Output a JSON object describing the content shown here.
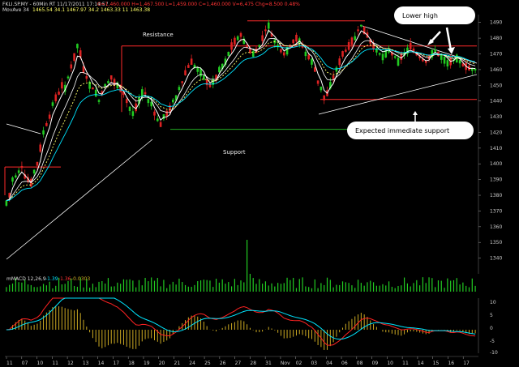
{
  "header": {
    "line1_symbol": "FKLI.SP.MY - 60Min RT   11/17/2011  17:14:57",
    "line1_ohlc": "O=1,460.000   H=1,467.500   L=1,459.000   C=1,460.000   V=6,475   Chg=8.500   0.48%",
    "line2_label": "MovAve 34",
    "line2_values": "1465.54   34.1   1467.97   34.2   1463.33    11   1463.38"
  },
  "annotations": {
    "resistance": "Resistance",
    "support": "Support",
    "lower_high": "Lower high",
    "expected_support": "Expected immediate support"
  },
  "macd_label": "mMACD 12,26,9",
  "macd_values": [
    "-1.39",
    "-1.36",
    "-0.0303"
  ],
  "colors": {
    "background": "#000000",
    "up_candle": "#22cc22",
    "down_candle": "#dd2222",
    "resistance": "#ff2a2a",
    "support": "#22aa22",
    "trendline": "#ffffff",
    "ma_white": "#ffffff",
    "ma_yellow": "#ffff66",
    "ma_cyan": "#00e5ff",
    "volume": "#22cc22",
    "macd_line": "#ff2222",
    "signal_line": "#00e5ff",
    "histogram": "#ccaa22",
    "axis_text": "#cccccc"
  },
  "chart_data": {
    "type": "candlestick",
    "instrument": "FKLI.SP.MY",
    "ylim": [
      1330,
      1495
    ],
    "y_ticks": [
      1340,
      1350,
      1360,
      1370,
      1380,
      1390,
      1400,
      1410,
      1420,
      1430,
      1440,
      1450,
      1460,
      1470,
      1480,
      1490
    ],
    "x_labels": [
      "11",
      "07",
      "10",
      "11",
      "12",
      "13",
      "14",
      "17",
      "18",
      "19",
      "20",
      "21",
      "24",
      "25",
      "26",
      "27",
      "28",
      "31",
      "Nov",
      "02",
      "03",
      "04",
      "06",
      "08",
      "09",
      "10",
      "11",
      "14",
      "15",
      "16",
      "17"
    ],
    "levels": {
      "resistance_top": 1491,
      "resistance_mid": 1475,
      "support": 1422,
      "expected_support": 1441,
      "box_top": 1398
    },
    "price_path": [
      1375,
      1380,
      1390,
      1392,
      1395,
      1398,
      1392,
      1390,
      1388,
      1395,
      1400,
      1410,
      1420,
      1425,
      1430,
      1438,
      1442,
      1445,
      1450,
      1448,
      1455,
      1462,
      1468,
      1475,
      1470,
      1460,
      1455,
      1450,
      1448,
      1445,
      1440,
      1445,
      1450,
      1452,
      1455,
      1452,
      1450,
      1448,
      1445,
      1440,
      1435,
      1432,
      1436,
      1440,
      1445,
      1445,
      1440,
      1438,
      1432,
      1428,
      1425,
      1430,
      1432,
      1435,
      1440,
      1442,
      1448,
      1452,
      1458,
      1462,
      1465,
      1462,
      1460,
      1458,
      1455,
      1452,
      1450,
      1452,
      1455,
      1460,
      1462,
      1465,
      1470,
      1475,
      1478,
      1480,
      1482,
      1478,
      1475,
      1472,
      1470,
      1472,
      1475,
      1480,
      1485,
      1488,
      1482,
      1478,
      1475,
      1472,
      1470,
      1472,
      1475,
      1478,
      1480,
      1478,
      1475,
      1470,
      1468,
      1465,
      1460,
      1452,
      1448,
      1442,
      1445,
      1450,
      1455,
      1460,
      1465,
      1470,
      1472,
      1475,
      1478,
      1480,
      1485,
      1488,
      1485,
      1482,
      1478,
      1475,
      1472,
      1470,
      1468,
      1470,
      1472,
      1470,
      1468,
      1465,
      1468,
      1470,
      1472,
      1475,
      1472,
      1470,
      1468,
      1466,
      1465,
      1468,
      1470,
      1472,
      1470,
      1468,
      1466,
      1464,
      1465,
      1466,
      1467,
      1465,
      1463,
      1462,
      1461,
      1460,
      1460
    ],
    "volume_peak_index": 78,
    "macd": {
      "label": "mMACD 12,26,9",
      "values": [
        -1.39,
        -1.36,
        -0.0303
      ]
    }
  }
}
